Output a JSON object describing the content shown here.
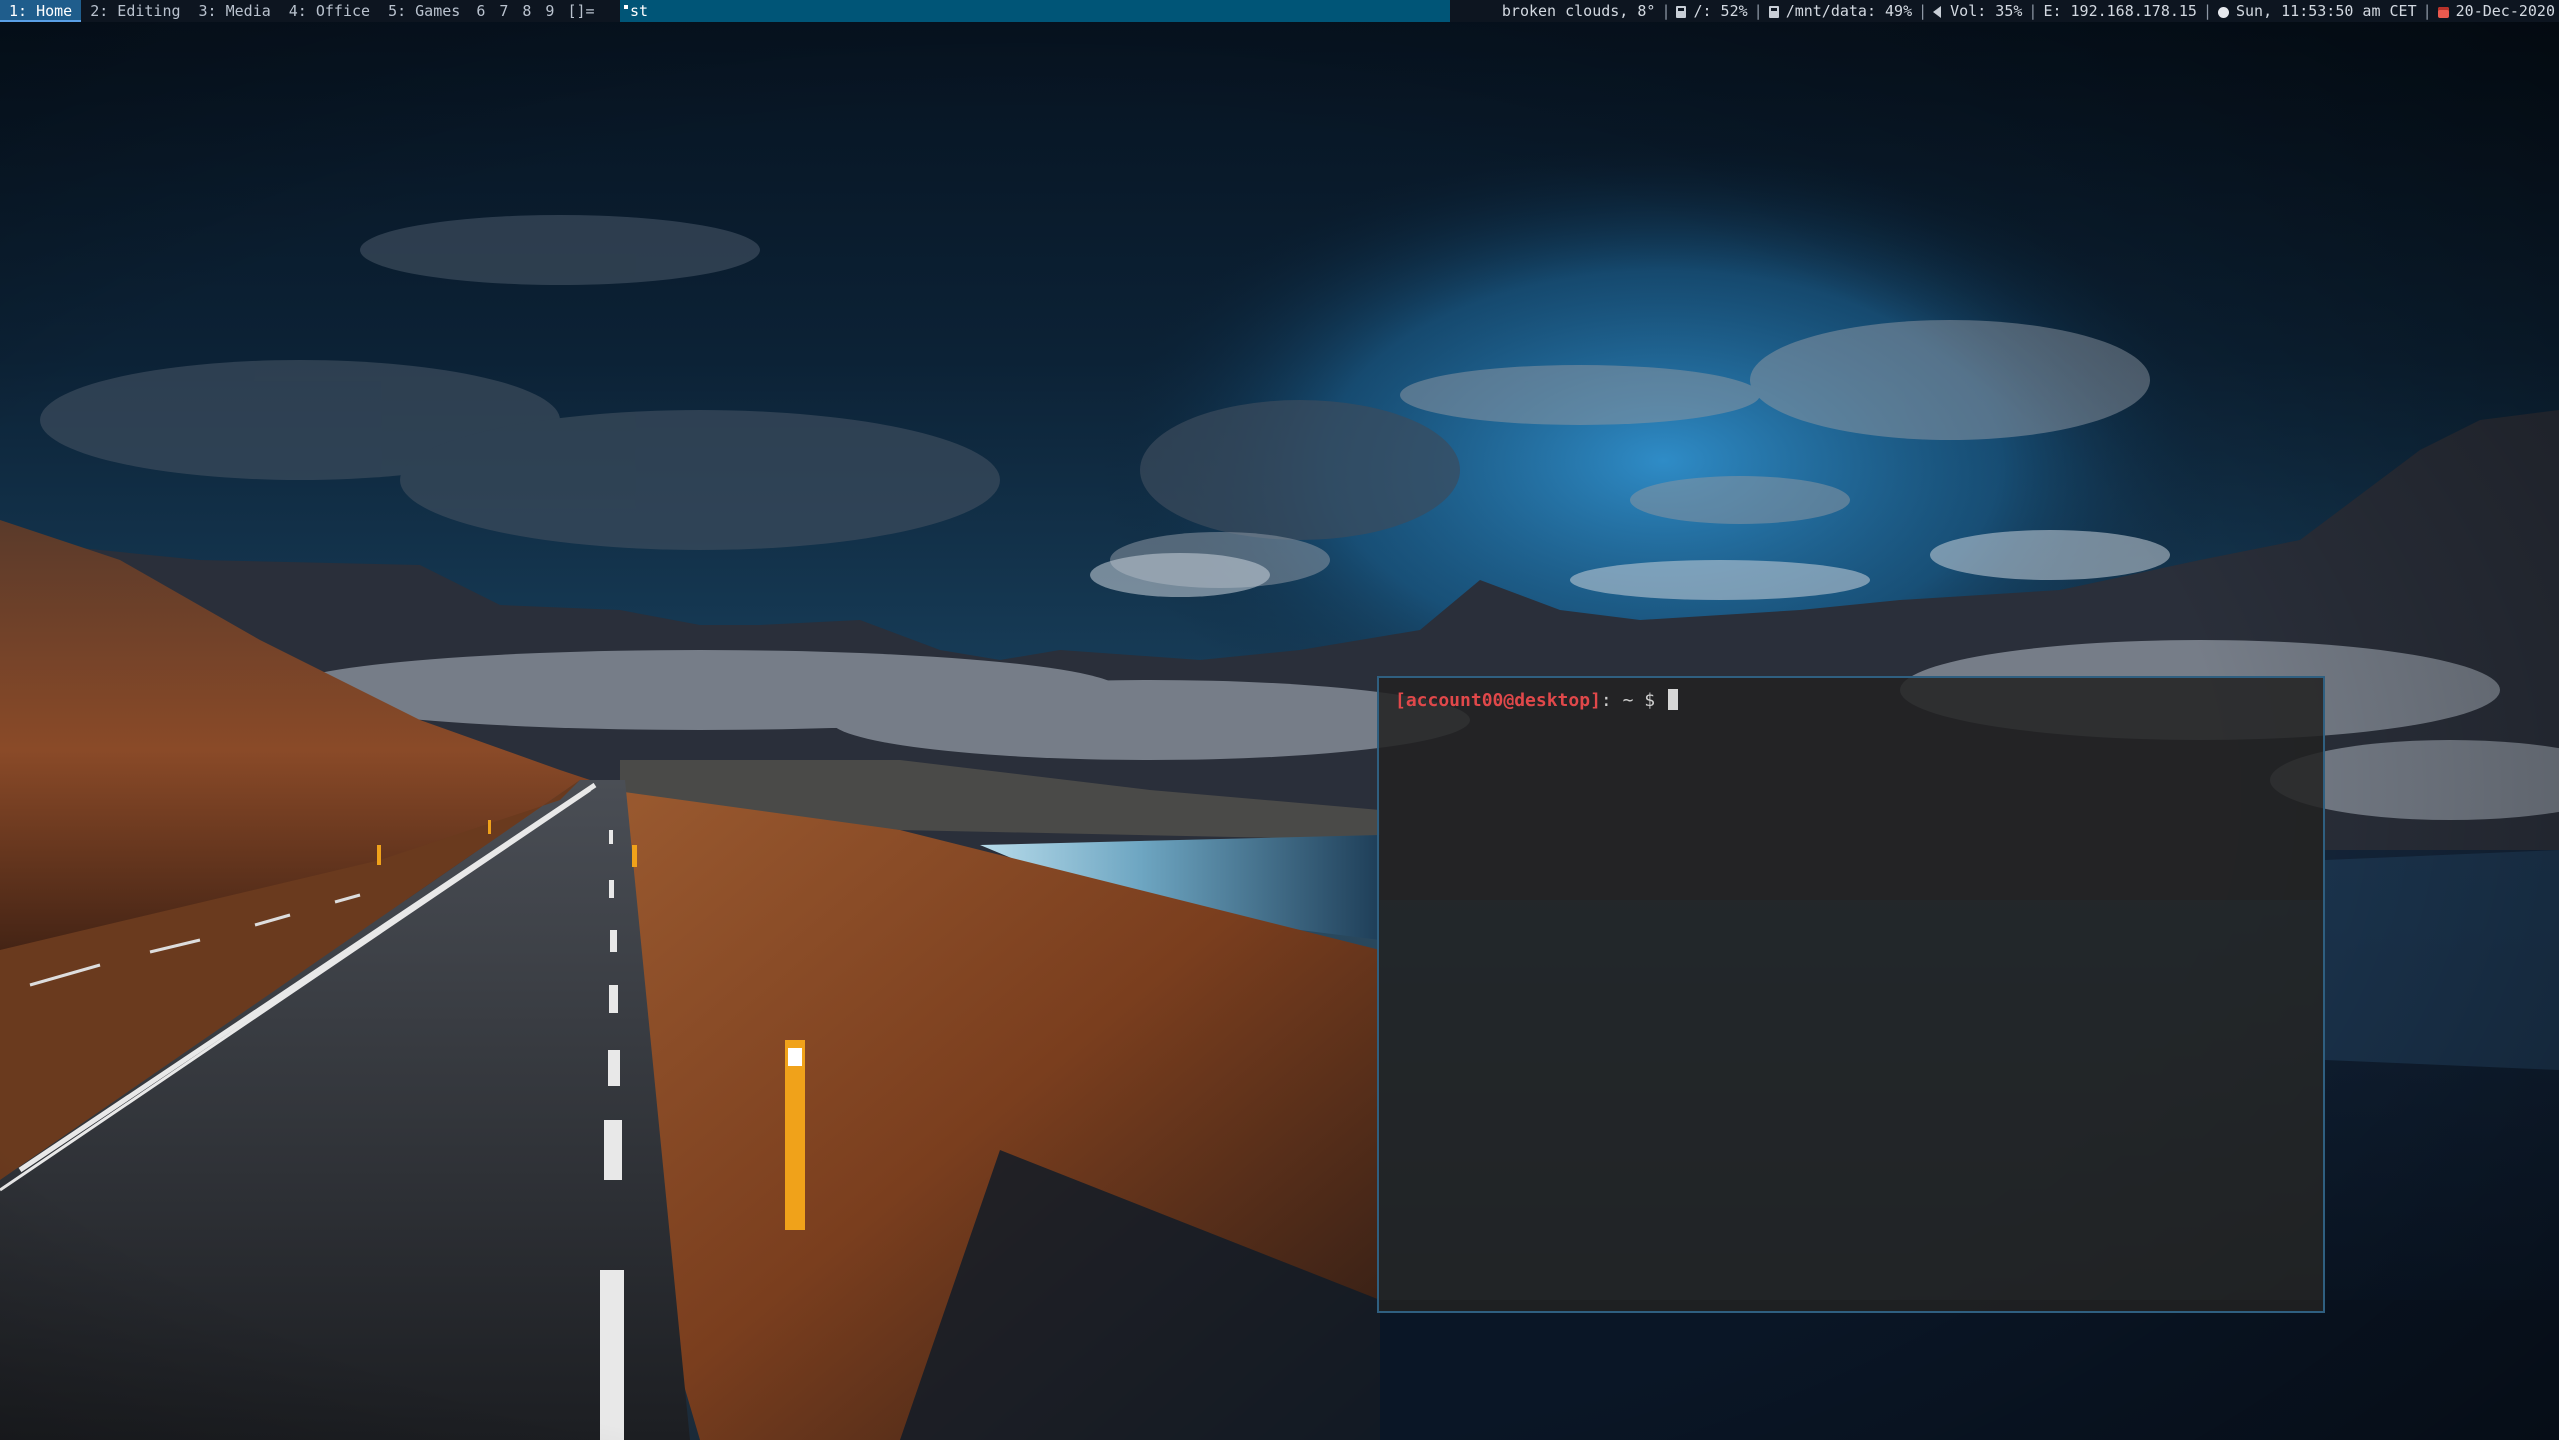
{
  "bar": {
    "tags": [
      {
        "label": "1: Home",
        "active": true
      },
      {
        "label": "2: Editing",
        "active": false
      },
      {
        "label": "3: Media",
        "active": false
      },
      {
        "label": "4: Office",
        "active": false
      },
      {
        "label": "5: Games",
        "active": false
      },
      {
        "label": "6",
        "active": false
      },
      {
        "label": "7",
        "active": false
      },
      {
        "label": "8",
        "active": false
      },
      {
        "label": "9",
        "active": false
      }
    ],
    "layout_symbol": "[]=",
    "window_title": "st",
    "status": {
      "weather": "broken clouds, 8°",
      "disk_root": "/: 52%",
      "disk_data": "/mnt/data: 49%",
      "volume": "Vol: 35%",
      "ethernet": "E: 192.168.178.15",
      "time": "Sun, 11:53:50 am CET",
      "date": "20-Dec-2020",
      "separator": "|"
    },
    "colors": {
      "bar_bg": "#0d1520",
      "accent": "#005577",
      "active_tag": "#1f5d8c"
    }
  },
  "terminal": {
    "prompt_user": "[account00@desktop]",
    "prompt_rest": ": ~ $ ",
    "colors": {
      "prompt": "#e0484a",
      "border": "#2f5f80"
    }
  },
  "wallpaper": {
    "icons": [
      "mountain-road-landscape"
    ]
  }
}
